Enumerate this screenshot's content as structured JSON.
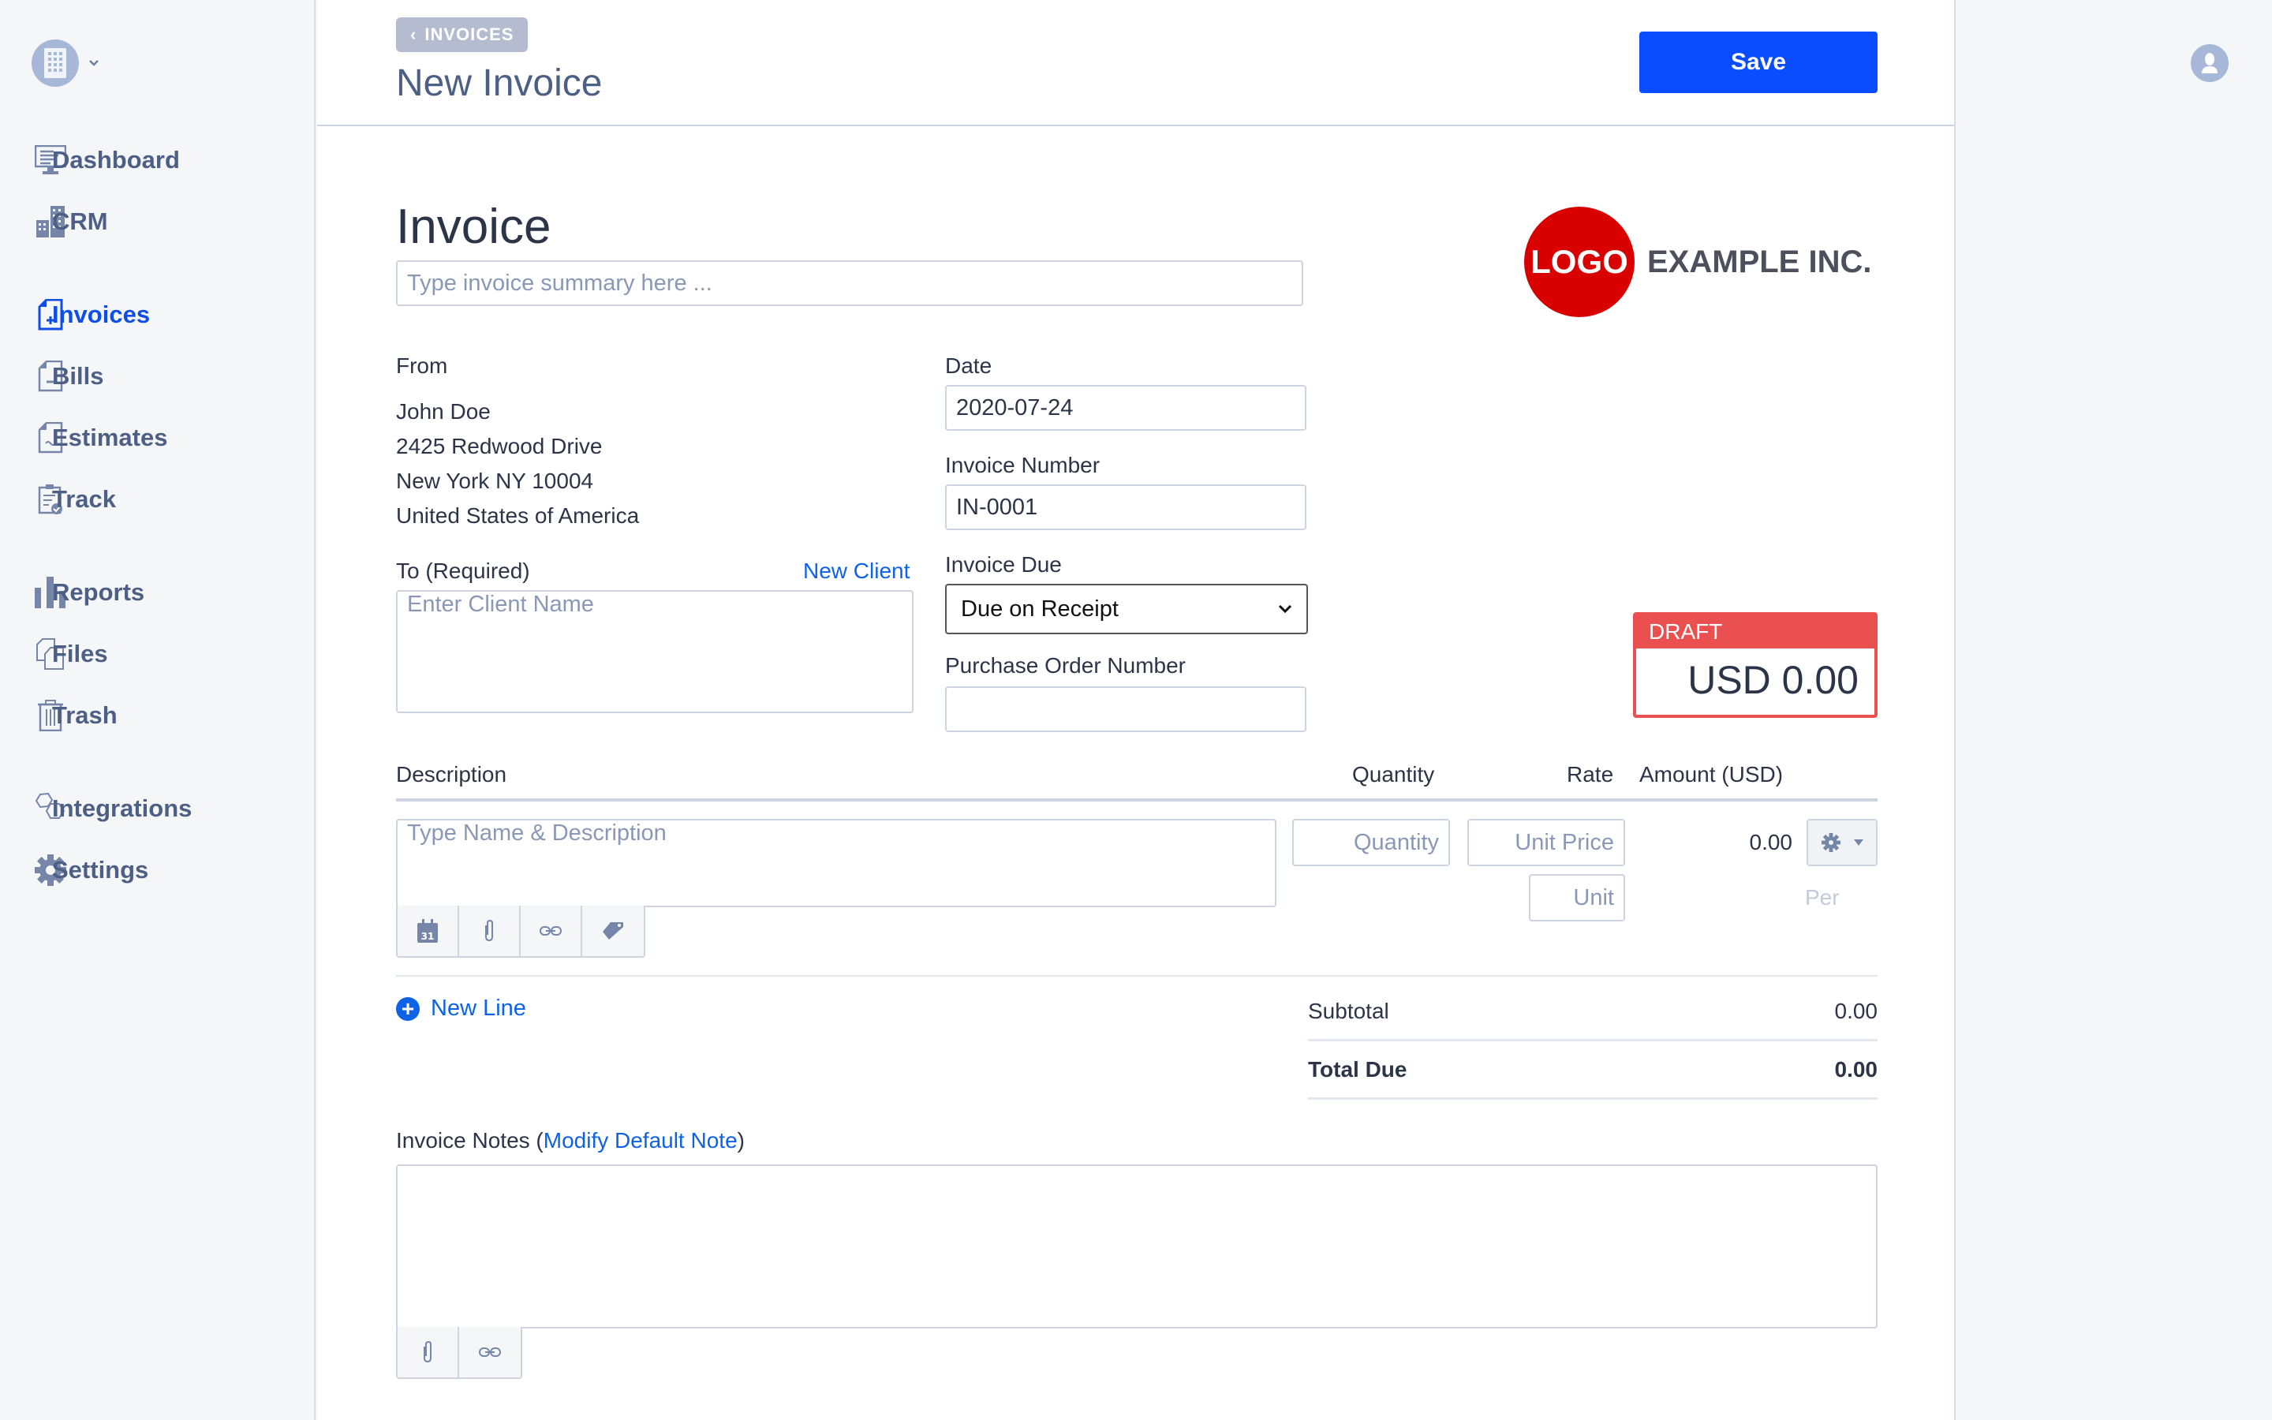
{
  "sidebar": {
    "org_icon": "building-icon",
    "items": [
      {
        "label": "Dashboard",
        "icon": "monitor-icon",
        "active": false
      },
      {
        "label": "CRM",
        "icon": "buildings-icon",
        "active": false
      },
      {
        "label": "Invoices",
        "icon": "invoice-plus-icon",
        "active": true
      },
      {
        "label": "Bills",
        "icon": "bill-minus-icon",
        "active": false
      },
      {
        "label": "Estimates",
        "icon": "estimate-icon",
        "active": false
      },
      {
        "label": "Track",
        "icon": "clipboard-check-icon",
        "active": false
      },
      {
        "label": "Reports",
        "icon": "bar-chart-icon",
        "active": false
      },
      {
        "label": "Files",
        "icon": "files-icon",
        "active": false
      },
      {
        "label": "Trash",
        "icon": "trash-icon",
        "active": false
      },
      {
        "label": "Integrations",
        "icon": "hexagons-icon",
        "active": false
      },
      {
        "label": "Settings",
        "icon": "gear-icon",
        "active": false
      }
    ]
  },
  "header": {
    "back_label": "INVOICES",
    "title": "New Invoice",
    "save_label": "Save"
  },
  "invoice": {
    "heading": "Invoice",
    "summary_placeholder": "Type invoice summary here ...",
    "logo_text": "LOGO",
    "company_name": "EXAMPLE INC.",
    "from_label": "From",
    "from_lines": [
      "John Doe",
      "2425 Redwood Drive",
      "New York NY 10004",
      "United States of America"
    ],
    "to_label": "To (Required)",
    "new_client_label": "New Client",
    "to_placeholder": "Enter Client Name",
    "date_label": "Date",
    "date_value": "2020-07-24",
    "number_label": "Invoice Number",
    "number_value": "IN-0001",
    "due_label": "Invoice Due",
    "due_value": "Due on Receipt",
    "po_label": "Purchase Order Number",
    "po_value": "",
    "status": "DRAFT",
    "status_amount": "USD 0.00",
    "status_color": "#eb5050"
  },
  "lines": {
    "headers": {
      "description": "Description",
      "quantity": "Quantity",
      "rate": "Rate",
      "amount": "Amount (USD)"
    },
    "desc_placeholder": "Type Name & Description",
    "qty_placeholder": "Quantity",
    "price_placeholder": "Unit Price",
    "per_label": "Per",
    "unit_placeholder": "Unit",
    "amount": "0.00",
    "new_line_label": "New Line"
  },
  "totals": {
    "subtotal_label": "Subtotal",
    "subtotal_value": "0.00",
    "total_label": "Total Due",
    "total_value": "0.00"
  },
  "notes": {
    "label": "Invoice Notes",
    "open_paren": "(",
    "link": "Modify Default Note",
    "close_paren": ")"
  },
  "colors": {
    "accent": "#0a4cff",
    "link": "#0e62e6",
    "draft": "#eb5050"
  }
}
